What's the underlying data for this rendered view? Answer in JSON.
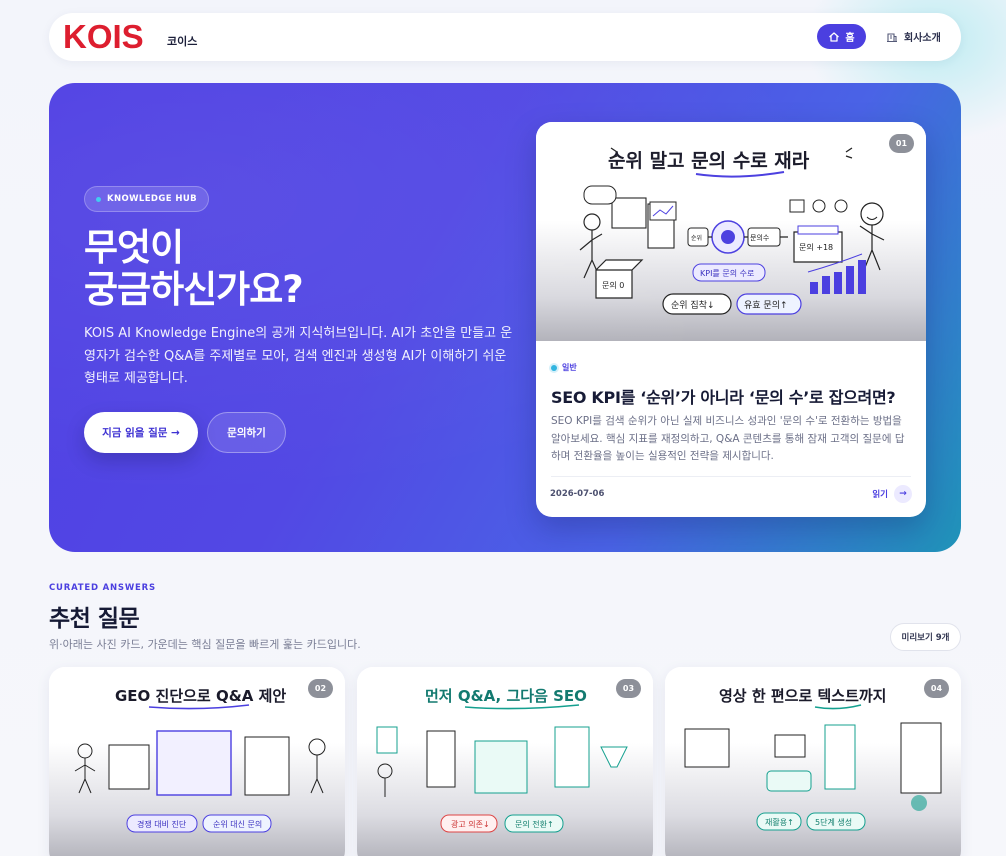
{
  "header": {
    "logo_text": "KOIS",
    "logo_sub": "코이스",
    "nav": [
      {
        "label": "홈",
        "icon": "home-icon",
        "active": true
      },
      {
        "label": "회사소개",
        "icon": "building-icon",
        "active": false
      }
    ]
  },
  "hero": {
    "badge": "KNOWLEDGE HUB",
    "title_line1": "무엇이",
    "title_line2": "궁금하신가요?",
    "description": "KOIS AI Knowledge Engine의 공개 지식허브입니다. AI가 초안을 만들고 운영자가 검수한 Q&A를 주제별로 모아, 검색 엔진과 생성형 AI가 이해하기 쉬운 형태로 제공합니다.",
    "primary_button": "지금 읽을 질문 →",
    "secondary_button": "문의하기"
  },
  "featured": {
    "number": "01",
    "illustration": {
      "title": "순위 말고 문의 수로 재라",
      "labels": [
        "KPI를 문의 수로",
        "순위 집착↓",
        "유효 문의↑",
        "문의 +18",
        "문의 0",
        "순위",
        "문의수"
      ]
    },
    "category": "일반",
    "title": "SEO KPI를 ‘순위’가 아니라 ‘문의 수’로 잡으려면?",
    "description": "SEO KPI를 검색 순위가 아닌 실제 비즈니스 성과인 '문의 수'로 전환하는 방법을 알아보세요. 핵심 지표를 재정의하고, Q&A 콘텐츠를 통해 잠재 고객의 질문에 답하며 전환율을 높이는 실용적인 전략을 제시합니다.",
    "date": "2026-07-06",
    "read_label": "읽기"
  },
  "curated": {
    "eyebrow": "CURATED ANSWERS",
    "title": "추천 질문",
    "subtitle": "위·아래는 사진 카드, 가운데는 핵심 질문을 빠르게 훑는 카드입니다.",
    "preview_button": "미리보기 9개",
    "cards": [
      {
        "number": "02",
        "sketch_title": "GEO 진단으로 Q&A 제안",
        "tags": [
          "경쟁 대비 진단",
          "순위 대신 문의"
        ]
      },
      {
        "number": "03",
        "sketch_title": "먼저 Q&A, 그다음 SEO",
        "tags": [
          "광고 의존↓",
          "문의 전환↑"
        ]
      },
      {
        "number": "04",
        "sketch_title": "영상 한 편으로 텍스트까지",
        "tags": [
          "재활용↑",
          "5단계 생성"
        ]
      }
    ]
  },
  "colors": {
    "brand_red": "#dd1e2f",
    "accent": "#4b3fe0",
    "hero_gradient_start": "#4f3fe3",
    "hero_gradient_end": "#1f93b8"
  }
}
